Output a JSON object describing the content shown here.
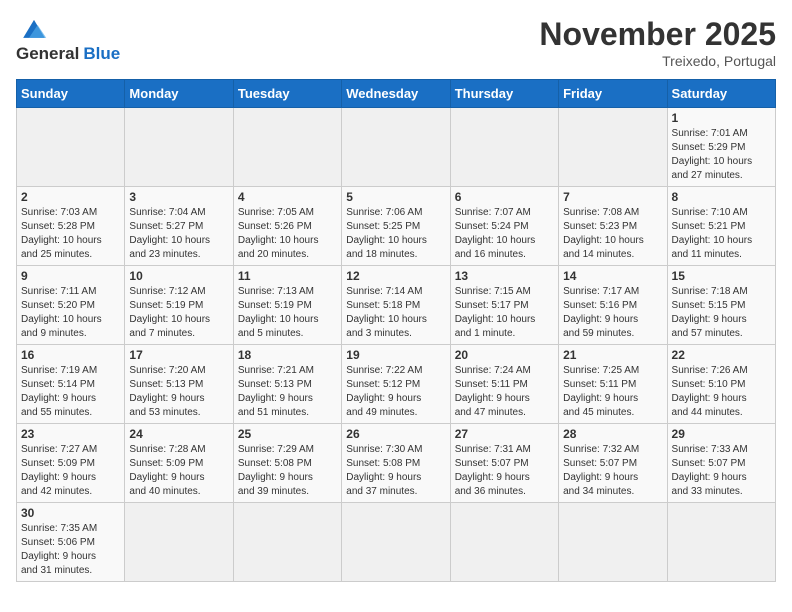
{
  "header": {
    "logo_general": "General",
    "logo_blue": "Blue",
    "month_title": "November 2025",
    "location": "Treixedo, Portugal"
  },
  "days_of_week": [
    "Sunday",
    "Monday",
    "Tuesday",
    "Wednesday",
    "Thursday",
    "Friday",
    "Saturday"
  ],
  "weeks": [
    [
      {
        "day": "",
        "info": ""
      },
      {
        "day": "",
        "info": ""
      },
      {
        "day": "",
        "info": ""
      },
      {
        "day": "",
        "info": ""
      },
      {
        "day": "",
        "info": ""
      },
      {
        "day": "",
        "info": ""
      },
      {
        "day": "1",
        "info": "Sunrise: 7:01 AM\nSunset: 5:29 PM\nDaylight: 10 hours\nand 27 minutes."
      }
    ],
    [
      {
        "day": "2",
        "info": "Sunrise: 7:03 AM\nSunset: 5:28 PM\nDaylight: 10 hours\nand 25 minutes."
      },
      {
        "day": "3",
        "info": "Sunrise: 7:04 AM\nSunset: 5:27 PM\nDaylight: 10 hours\nand 23 minutes."
      },
      {
        "day": "4",
        "info": "Sunrise: 7:05 AM\nSunset: 5:26 PM\nDaylight: 10 hours\nand 20 minutes."
      },
      {
        "day": "5",
        "info": "Sunrise: 7:06 AM\nSunset: 5:25 PM\nDaylight: 10 hours\nand 18 minutes."
      },
      {
        "day": "6",
        "info": "Sunrise: 7:07 AM\nSunset: 5:24 PM\nDaylight: 10 hours\nand 16 minutes."
      },
      {
        "day": "7",
        "info": "Sunrise: 7:08 AM\nSunset: 5:23 PM\nDaylight: 10 hours\nand 14 minutes."
      },
      {
        "day": "8",
        "info": "Sunrise: 7:10 AM\nSunset: 5:21 PM\nDaylight: 10 hours\nand 11 minutes."
      }
    ],
    [
      {
        "day": "9",
        "info": "Sunrise: 7:11 AM\nSunset: 5:20 PM\nDaylight: 10 hours\nand 9 minutes."
      },
      {
        "day": "10",
        "info": "Sunrise: 7:12 AM\nSunset: 5:19 PM\nDaylight: 10 hours\nand 7 minutes."
      },
      {
        "day": "11",
        "info": "Sunrise: 7:13 AM\nSunset: 5:19 PM\nDaylight: 10 hours\nand 5 minutes."
      },
      {
        "day": "12",
        "info": "Sunrise: 7:14 AM\nSunset: 5:18 PM\nDaylight: 10 hours\nand 3 minutes."
      },
      {
        "day": "13",
        "info": "Sunrise: 7:15 AM\nSunset: 5:17 PM\nDaylight: 10 hours\nand 1 minute."
      },
      {
        "day": "14",
        "info": "Sunrise: 7:17 AM\nSunset: 5:16 PM\nDaylight: 9 hours\nand 59 minutes."
      },
      {
        "day": "15",
        "info": "Sunrise: 7:18 AM\nSunset: 5:15 PM\nDaylight: 9 hours\nand 57 minutes."
      }
    ],
    [
      {
        "day": "16",
        "info": "Sunrise: 7:19 AM\nSunset: 5:14 PM\nDaylight: 9 hours\nand 55 minutes."
      },
      {
        "day": "17",
        "info": "Sunrise: 7:20 AM\nSunset: 5:13 PM\nDaylight: 9 hours\nand 53 minutes."
      },
      {
        "day": "18",
        "info": "Sunrise: 7:21 AM\nSunset: 5:13 PM\nDaylight: 9 hours\nand 51 minutes."
      },
      {
        "day": "19",
        "info": "Sunrise: 7:22 AM\nSunset: 5:12 PM\nDaylight: 9 hours\nand 49 minutes."
      },
      {
        "day": "20",
        "info": "Sunrise: 7:24 AM\nSunset: 5:11 PM\nDaylight: 9 hours\nand 47 minutes."
      },
      {
        "day": "21",
        "info": "Sunrise: 7:25 AM\nSunset: 5:11 PM\nDaylight: 9 hours\nand 45 minutes."
      },
      {
        "day": "22",
        "info": "Sunrise: 7:26 AM\nSunset: 5:10 PM\nDaylight: 9 hours\nand 44 minutes."
      }
    ],
    [
      {
        "day": "23",
        "info": "Sunrise: 7:27 AM\nSunset: 5:09 PM\nDaylight: 9 hours\nand 42 minutes."
      },
      {
        "day": "24",
        "info": "Sunrise: 7:28 AM\nSunset: 5:09 PM\nDaylight: 9 hours\nand 40 minutes."
      },
      {
        "day": "25",
        "info": "Sunrise: 7:29 AM\nSunset: 5:08 PM\nDaylight: 9 hours\nand 39 minutes."
      },
      {
        "day": "26",
        "info": "Sunrise: 7:30 AM\nSunset: 5:08 PM\nDaylight: 9 hours\nand 37 minutes."
      },
      {
        "day": "27",
        "info": "Sunrise: 7:31 AM\nSunset: 5:07 PM\nDaylight: 9 hours\nand 36 minutes."
      },
      {
        "day": "28",
        "info": "Sunrise: 7:32 AM\nSunset: 5:07 PM\nDaylight: 9 hours\nand 34 minutes."
      },
      {
        "day": "29",
        "info": "Sunrise: 7:33 AM\nSunset: 5:07 PM\nDaylight: 9 hours\nand 33 minutes."
      }
    ],
    [
      {
        "day": "30",
        "info": "Sunrise: 7:35 AM\nSunset: 5:06 PM\nDaylight: 9 hours\nand 31 minutes."
      },
      {
        "day": "",
        "info": ""
      },
      {
        "day": "",
        "info": ""
      },
      {
        "day": "",
        "info": ""
      },
      {
        "day": "",
        "info": ""
      },
      {
        "day": "",
        "info": ""
      },
      {
        "day": "",
        "info": ""
      }
    ]
  ]
}
